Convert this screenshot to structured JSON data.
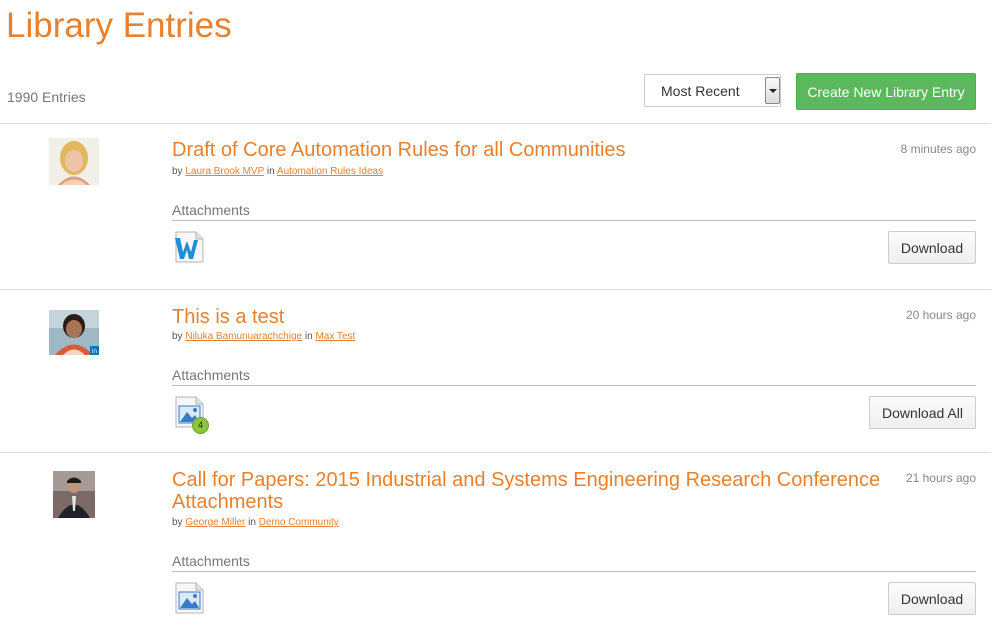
{
  "header": {
    "title": "Library Entries",
    "entry_count": "1990 Entries",
    "sort": {
      "selected": "Most Recent"
    },
    "create_label": "Create New Library Entry"
  },
  "colors": {
    "accent": "#e8812f",
    "create_button": "#5cb85c",
    "badge": "#8cc63f"
  },
  "entries": [
    {
      "title": "Draft of Core Automation Rules for all Communities",
      "by_prefix": "by",
      "author": "Laura Brook MVP",
      "in_word": "in",
      "community": "Automation Rules Ideas",
      "time": "8 minutes ago",
      "attachments_label": "Attachments",
      "file_icon": "word-document-icon",
      "button_label": "Download"
    },
    {
      "title": "This is a test",
      "by_prefix": "by",
      "author": "Niluka Bamunuarachchige",
      "in_word": "in",
      "community": "Max Test",
      "time": "20 hours ago",
      "attachments_label": "Attachments",
      "file_icon": "image-file-icon",
      "attachment_count": "4",
      "button_label": "Download All"
    },
    {
      "title_line1": "Call for Papers: 2015 Industrial and Systems Engineering Research Conference",
      "title_line2": "Attachments",
      "by_prefix": "by",
      "author": "George Miller",
      "in_word": "in",
      "community": "Demo Community",
      "time": "21 hours ago",
      "attachments_label": "Attachments",
      "file_icon": "image-file-icon",
      "button_label": "Download"
    }
  ]
}
